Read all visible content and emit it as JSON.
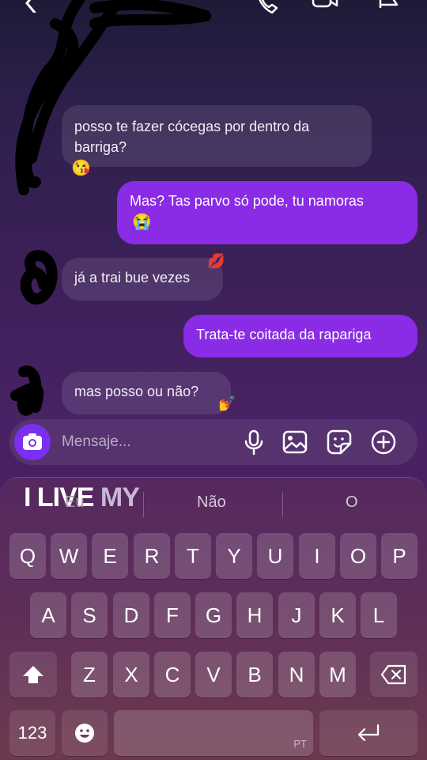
{
  "composer": {
    "placeholder": "Mensaje..."
  },
  "messages": [
    {
      "side": "in",
      "text": "posso te fazer cócegas por dentro da barriga?",
      "emoji": "😘"
    },
    {
      "side": "out",
      "text": "Mas? Tas parvo só pode, tu namoras",
      "emoji": "😭"
    },
    {
      "side": "in",
      "text": "já a trai bue vezes",
      "reaction": "💋"
    },
    {
      "side": "out",
      "text": "Trata-te coitada da rapariga"
    },
    {
      "side": "in",
      "text": "mas posso ou não?",
      "reaction": "💅"
    }
  ],
  "keyboard": {
    "overlay_left": "I LIVE",
    "overlay_right": "MY",
    "suggestions": [
      "Eu",
      "Não",
      "O"
    ],
    "row1": [
      "Q",
      "W",
      "E",
      "R",
      "T",
      "Y",
      "U",
      "I",
      "O",
      "P"
    ],
    "row2": [
      "A",
      "S",
      "D",
      "F",
      "G",
      "H",
      "J",
      "K",
      "L"
    ],
    "row3": [
      "Z",
      "X",
      "C",
      "V",
      "B",
      "N",
      "M"
    ],
    "numbers_key": "123",
    "language": "PT"
  },
  "colors": {
    "outgoing_bubble": "#8a2be6",
    "camera_button": "#7b2ff0"
  }
}
